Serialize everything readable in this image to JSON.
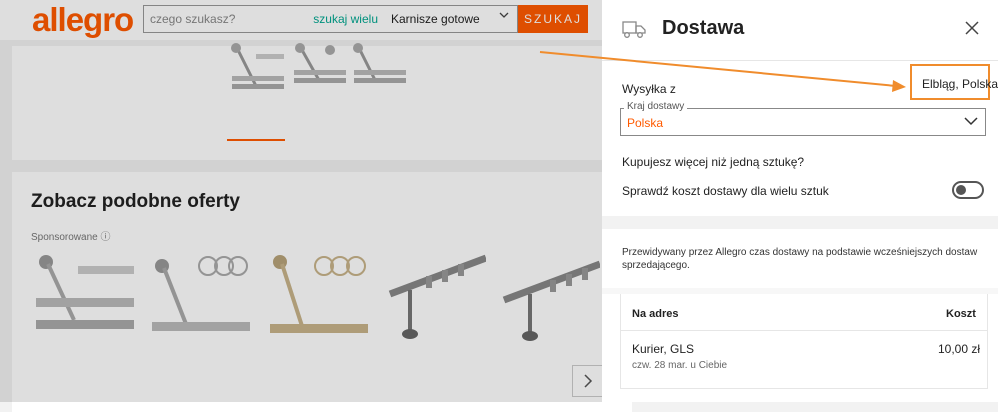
{
  "header": {
    "logo": "allegro",
    "search_placeholder": "czego szukasz?",
    "search_in_many": "szukaj wielu",
    "category": "Karnisze gotowe",
    "search_button": "SZUKAJ"
  },
  "similar": {
    "title": "Zobacz podobne oferty",
    "sponsored": "Sponsorowane ⓘ"
  },
  "panel": {
    "title": "Dostawa",
    "ship_from_label": "Wysyłka z",
    "ship_from_value": "Elbląg, Polska",
    "country_legend": "Kraj dostawy",
    "country_value": "Polska",
    "multi_question": "Kupujesz więcej niż jedną sztukę?",
    "multi_check": "Sprawdź koszt dostawy dla wielu sztuk",
    "multi_toggle_on": false,
    "info": "Przewidywany przez Allegro czas dostawy na podstawie wcześniejszych dostaw sprzedającego.",
    "table": {
      "col_address": "Na adres",
      "col_cost": "Koszt",
      "rows": [
        {
          "carrier": "Kurier, GLS",
          "eta": "czw. 28 mar. u Ciebie",
          "cost": "10,00 zł"
        }
      ]
    }
  },
  "colors": {
    "accent": "#ff5a00",
    "annotation": "#f08c2c",
    "link": "#00a790"
  }
}
